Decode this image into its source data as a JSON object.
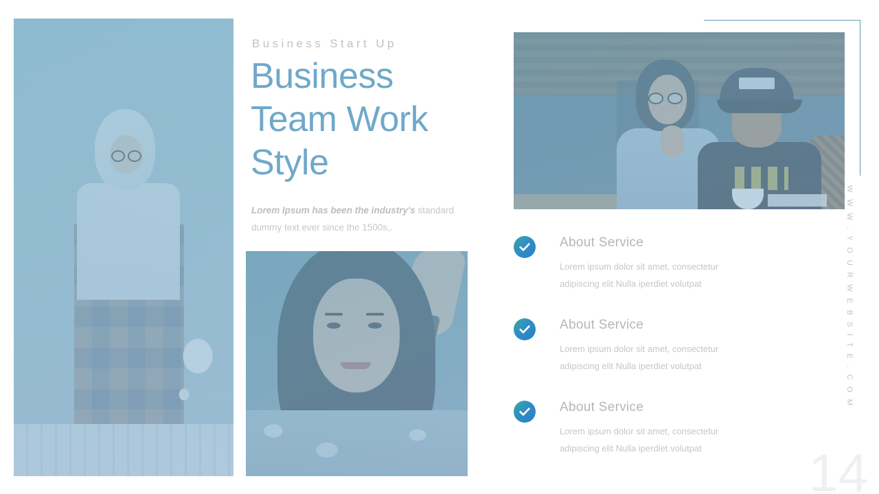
{
  "slide": {
    "page_number": "14",
    "vertical_url": "W W W . Y O U R W E B S I T E . C O M",
    "accent_color": "#6fa8c9",
    "frame_color": "#5e9bb5",
    "check_gradient_from": "#3aa8a0",
    "check_gradient_to": "#2b7fc9"
  },
  "headline": {
    "eyebrow": "Business Start Up",
    "title_line1": "Business",
    "title_line2": "Team Work",
    "title_line3": "Style",
    "lead_bold": "Lorem Ipsum has been the industry's",
    "lead_rest": " standard dummy text ever since the 1500s,."
  },
  "features": [
    {
      "icon": "check-circle-icon",
      "title": "About Service",
      "body": "Lorem ipsum dolor sit amet, consectetur adipiscing elit Nulla iperdiet volutpat"
    },
    {
      "icon": "check-circle-icon",
      "title": "About Service",
      "body": "Lorem ipsum dolor sit amet, consectetur adipiscing elit Nulla iperdiet volutpat"
    },
    {
      "icon": "check-circle-icon",
      "title": "About Service",
      "body": "Lorem ipsum dolor sit amet, consectetur adipiscing elit Nulla iperdiet volutpat"
    }
  ],
  "images": [
    {
      "name": "left-portrait-photo",
      "alt": "Woman in hijab with plaid dress and white backpack"
    },
    {
      "name": "center-portrait-photo",
      "alt": "Close-up portrait of woman with long dark hair"
    },
    {
      "name": "top-right-team-photo",
      "alt": "Two people working together at a cafe table"
    }
  ]
}
